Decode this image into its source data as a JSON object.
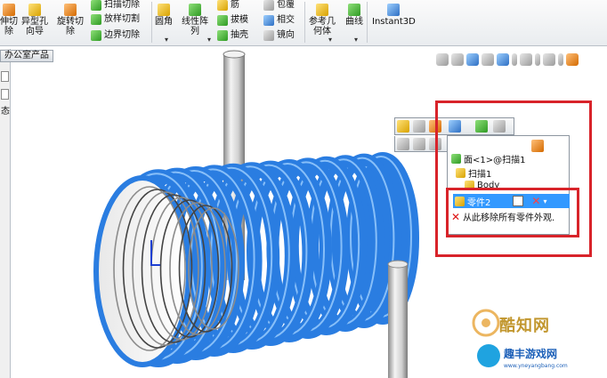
{
  "ribbon": {
    "btn_extrude_cut": "伸切\n除",
    "btn_hole_wizard": "异型孔\n向导",
    "btn_revolve_cut": "旋转切\n除",
    "btn_swept_cut": "扫描切除",
    "btn_lofted_cut": "放样切割",
    "btn_boundary_cut": "边界切除",
    "btn_fillet": "圆角",
    "btn_linear_pattern": "线性阵\n列",
    "btn_rib": "筋",
    "btn_draft": "拔模",
    "btn_shell": "抽壳",
    "btn_wrap": "包覆",
    "btn_intersect": "相交",
    "btn_mirror": "镜向",
    "btn_ref_geometry": "参考几\n何体",
    "btn_curves": "曲线",
    "btn_instant3d": "Instant3D"
  },
  "left_panel": {
    "tab_label": "办公室产品",
    "side_label": "态"
  },
  "appearance_popup": {
    "face_item": "面<1>@扫描1",
    "sweep_item": "扫描1",
    "body_item": "Body",
    "part_item": "零件2",
    "remove_label": "从此移除所有零件外观."
  },
  "watermark": {
    "brand": "酷知网",
    "badge_title": "趣丰游戏网",
    "badge_url": "www.yneyangbang.com"
  },
  "colors": {
    "coil_blue": "#2a7de1",
    "highlight_red": "#d8232a",
    "selection_blue": "#3399ff"
  }
}
